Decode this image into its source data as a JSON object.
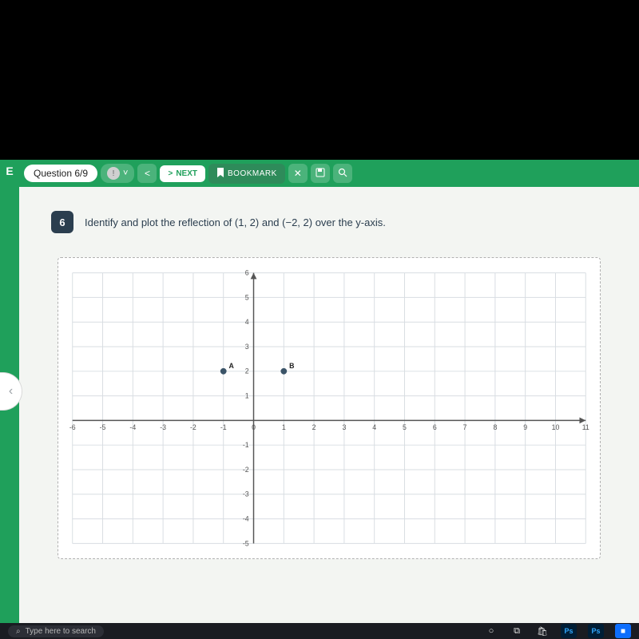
{
  "toolbar": {
    "logo": "E",
    "counter": "Question 6/9",
    "prev_symbol": "<",
    "next_symbol": ">",
    "next_label": "NEXT",
    "bookmark_label": "BOOKMARK",
    "bookmark_icon": "🔖",
    "close_symbol": "✕",
    "save_icon": "💾",
    "search_icon": "🔍",
    "alert_icon": "!",
    "chevron_down": "˅"
  },
  "left_chevron": "‹",
  "question": {
    "number": "6",
    "text": "Identify and plot the reflection of (1, 2) and (−2,  2) over the y-axis."
  },
  "chart_data": {
    "type": "scatter",
    "xlabel": "",
    "ylabel": "",
    "xlim": [
      -6,
      11
    ],
    "ylim": [
      -5,
      6
    ],
    "x_ticks": [
      -6,
      -5,
      -4,
      -3,
      -2,
      -1,
      0,
      1,
      2,
      3,
      4,
      5,
      6,
      7,
      8,
      9,
      10,
      11
    ],
    "y_ticks_pos": [
      1,
      2,
      3,
      4,
      5,
      6
    ],
    "y_ticks_neg": [
      -1,
      -2,
      -3,
      -4,
      -5
    ],
    "points": [
      {
        "label": "A",
        "x": -1,
        "y": 2
      },
      {
        "label": "B",
        "x": 1,
        "y": 2
      }
    ]
  },
  "taskbar": {
    "search_placeholder": "Type here to search",
    "search_icon": "⌕",
    "cortana": "○",
    "taskview": "⧉",
    "store": "🛍",
    "ps": "Ps",
    "cam": "■"
  }
}
